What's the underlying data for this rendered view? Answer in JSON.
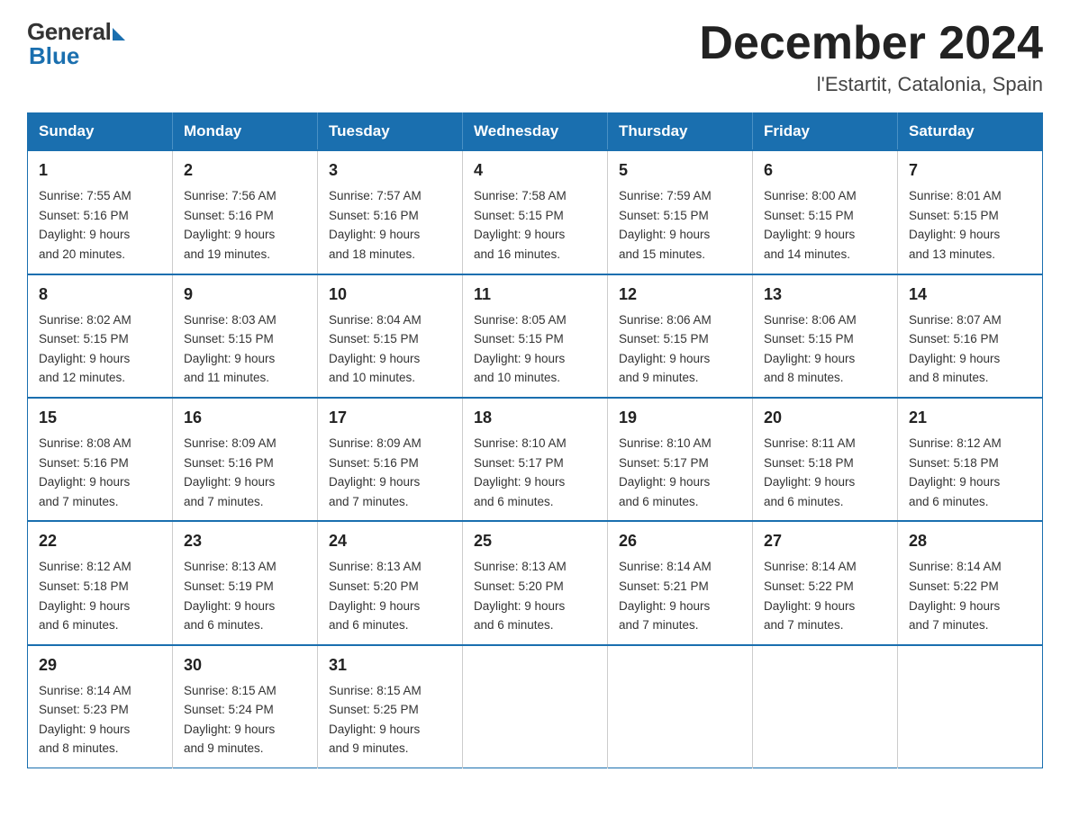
{
  "header": {
    "logo_general": "General",
    "logo_blue": "Blue",
    "month_title": "December 2024",
    "location": "l'Estartit, Catalonia, Spain"
  },
  "days_of_week": [
    "Sunday",
    "Monday",
    "Tuesday",
    "Wednesday",
    "Thursday",
    "Friday",
    "Saturday"
  ],
  "weeks": [
    [
      {
        "day": "1",
        "sunrise": "7:55 AM",
        "sunset": "5:16 PM",
        "daylight": "9 hours and 20 minutes."
      },
      {
        "day": "2",
        "sunrise": "7:56 AM",
        "sunset": "5:16 PM",
        "daylight": "9 hours and 19 minutes."
      },
      {
        "day": "3",
        "sunrise": "7:57 AM",
        "sunset": "5:16 PM",
        "daylight": "9 hours and 18 minutes."
      },
      {
        "day": "4",
        "sunrise": "7:58 AM",
        "sunset": "5:15 PM",
        "daylight": "9 hours and 16 minutes."
      },
      {
        "day": "5",
        "sunrise": "7:59 AM",
        "sunset": "5:15 PM",
        "daylight": "9 hours and 15 minutes."
      },
      {
        "day": "6",
        "sunrise": "8:00 AM",
        "sunset": "5:15 PM",
        "daylight": "9 hours and 14 minutes."
      },
      {
        "day": "7",
        "sunrise": "8:01 AM",
        "sunset": "5:15 PM",
        "daylight": "9 hours and 13 minutes."
      }
    ],
    [
      {
        "day": "8",
        "sunrise": "8:02 AM",
        "sunset": "5:15 PM",
        "daylight": "9 hours and 12 minutes."
      },
      {
        "day": "9",
        "sunrise": "8:03 AM",
        "sunset": "5:15 PM",
        "daylight": "9 hours and 11 minutes."
      },
      {
        "day": "10",
        "sunrise": "8:04 AM",
        "sunset": "5:15 PM",
        "daylight": "9 hours and 10 minutes."
      },
      {
        "day": "11",
        "sunrise": "8:05 AM",
        "sunset": "5:15 PM",
        "daylight": "9 hours and 10 minutes."
      },
      {
        "day": "12",
        "sunrise": "8:06 AM",
        "sunset": "5:15 PM",
        "daylight": "9 hours and 9 minutes."
      },
      {
        "day": "13",
        "sunrise": "8:06 AM",
        "sunset": "5:15 PM",
        "daylight": "9 hours and 8 minutes."
      },
      {
        "day": "14",
        "sunrise": "8:07 AM",
        "sunset": "5:16 PM",
        "daylight": "9 hours and 8 minutes."
      }
    ],
    [
      {
        "day": "15",
        "sunrise": "8:08 AM",
        "sunset": "5:16 PM",
        "daylight": "9 hours and 7 minutes."
      },
      {
        "day": "16",
        "sunrise": "8:09 AM",
        "sunset": "5:16 PM",
        "daylight": "9 hours and 7 minutes."
      },
      {
        "day": "17",
        "sunrise": "8:09 AM",
        "sunset": "5:16 PM",
        "daylight": "9 hours and 7 minutes."
      },
      {
        "day": "18",
        "sunrise": "8:10 AM",
        "sunset": "5:17 PM",
        "daylight": "9 hours and 6 minutes."
      },
      {
        "day": "19",
        "sunrise": "8:10 AM",
        "sunset": "5:17 PM",
        "daylight": "9 hours and 6 minutes."
      },
      {
        "day": "20",
        "sunrise": "8:11 AM",
        "sunset": "5:18 PM",
        "daylight": "9 hours and 6 minutes."
      },
      {
        "day": "21",
        "sunrise": "8:12 AM",
        "sunset": "5:18 PM",
        "daylight": "9 hours and 6 minutes."
      }
    ],
    [
      {
        "day": "22",
        "sunrise": "8:12 AM",
        "sunset": "5:18 PM",
        "daylight": "9 hours and 6 minutes."
      },
      {
        "day": "23",
        "sunrise": "8:13 AM",
        "sunset": "5:19 PM",
        "daylight": "9 hours and 6 minutes."
      },
      {
        "day": "24",
        "sunrise": "8:13 AM",
        "sunset": "5:20 PM",
        "daylight": "9 hours and 6 minutes."
      },
      {
        "day": "25",
        "sunrise": "8:13 AM",
        "sunset": "5:20 PM",
        "daylight": "9 hours and 6 minutes."
      },
      {
        "day": "26",
        "sunrise": "8:14 AM",
        "sunset": "5:21 PM",
        "daylight": "9 hours and 7 minutes."
      },
      {
        "day": "27",
        "sunrise": "8:14 AM",
        "sunset": "5:22 PM",
        "daylight": "9 hours and 7 minutes."
      },
      {
        "day": "28",
        "sunrise": "8:14 AM",
        "sunset": "5:22 PM",
        "daylight": "9 hours and 7 minutes."
      }
    ],
    [
      {
        "day": "29",
        "sunrise": "8:14 AM",
        "sunset": "5:23 PM",
        "daylight": "9 hours and 8 minutes."
      },
      {
        "day": "30",
        "sunrise": "8:15 AM",
        "sunset": "5:24 PM",
        "daylight": "9 hours and 9 minutes."
      },
      {
        "day": "31",
        "sunrise": "8:15 AM",
        "sunset": "5:25 PM",
        "daylight": "9 hours and 9 minutes."
      },
      null,
      null,
      null,
      null
    ]
  ],
  "labels": {
    "sunrise": "Sunrise:",
    "sunset": "Sunset:",
    "daylight": "Daylight:"
  }
}
